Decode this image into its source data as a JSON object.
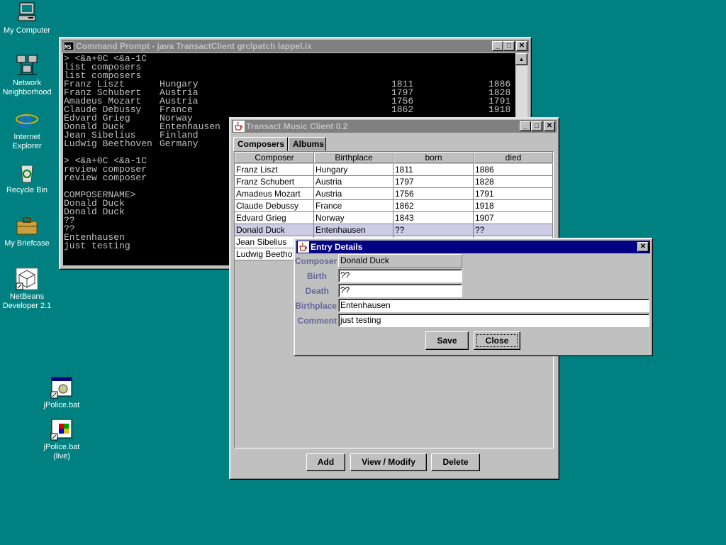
{
  "desktop_icons": [
    {
      "label": "My Computer",
      "icon": "computer-icon"
    },
    {
      "label": "Network Neighborhood",
      "icon": "network-icon"
    },
    {
      "label": "Internet Explorer",
      "icon": "ie-icon"
    },
    {
      "label": "Recycle Bin",
      "icon": "recycle-bin-icon"
    },
    {
      "label": "My Briefcase",
      "icon": "briefcase-icon"
    },
    {
      "label": "NetBeans Developer 2.1",
      "icon": "netbeans-icon"
    },
    {
      "label": "jPolice.bat",
      "icon": "batch-file-icon"
    },
    {
      "label": "jPolice.bat (live)",
      "icon": "batch-file-icon"
    }
  ],
  "console_window": {
    "title": "Command Prompt - java TransactClient grclpatch lappel.ix",
    "lines": [
      {
        "text": "> <&a+0C <&a-1C"
      },
      {
        "text": "list composers"
      },
      {
        "text": "list composers"
      },
      {
        "cols": [
          "Franz Liszt",
          "Hungary",
          "1811",
          "1886"
        ]
      },
      {
        "cols": [
          "Franz Schubert",
          "Austria",
          "1797",
          "1828"
        ]
      },
      {
        "cols": [
          "Amadeus Mozart",
          "Austria",
          "1756",
          "1791"
        ]
      },
      {
        "cols": [
          "Claude Debussy",
          "France",
          "1862",
          "1918"
        ]
      },
      {
        "cols": [
          "Edvard Grieg",
          "Norway",
          "",
          ""
        ]
      },
      {
        "cols": [
          "Donald Duck",
          "Entenhausen",
          "",
          ""
        ]
      },
      {
        "cols": [
          "Jean Sibelius",
          "Finland",
          "",
          ""
        ]
      },
      {
        "cols": [
          "Ludwig Beethoven",
          "Germany",
          "",
          ""
        ]
      },
      {
        "text": ""
      },
      {
        "text": "> <&a+0C <&a-1C"
      },
      {
        "text": "review composer"
      },
      {
        "text": "review composer"
      },
      {
        "text": ""
      },
      {
        "text": "COMPOSERNAME>"
      },
      {
        "text": "Donald Duck"
      },
      {
        "text": "Donald Duck"
      },
      {
        "text": "??"
      },
      {
        "text": "??"
      },
      {
        "text": "Entenhausen"
      },
      {
        "text": "just testing"
      }
    ]
  },
  "music_window": {
    "title": "Transact Music Client 0.2",
    "tabs": [
      "Composers",
      "Albums"
    ],
    "columns": [
      "Composer",
      "Birthplace",
      "born",
      "died"
    ],
    "rows": [
      [
        "Franz Liszt",
        "Hungary",
        "1811",
        "1886"
      ],
      [
        "Franz Schubert",
        "Austria",
        "1797",
        "1828"
      ],
      [
        "Amadeus Mozart",
        "Austria",
        "1756",
        "1791"
      ],
      [
        "Claude Debussy",
        "France",
        "1862",
        "1918"
      ],
      [
        "Edvard Grieg",
        "Norway",
        "1843",
        "1907"
      ],
      [
        "Donald Duck",
        "Entenhausen",
        "??",
        "??"
      ],
      [
        "Jean Sibelius",
        "",
        "",
        ""
      ],
      [
        "Ludwig Beetho",
        "",
        "",
        ""
      ]
    ],
    "selected_row": 5,
    "buttons": {
      "add": "Add",
      "view_modify": "View / Modify",
      "delete": "Delete"
    }
  },
  "dialog": {
    "title": "Entry Details",
    "labels": {
      "composer": "Composer",
      "birth": "Birth",
      "death": "Death",
      "birthplace": "Birthplace",
      "comment": "Comment"
    },
    "values": {
      "composer": "Donald Duck",
      "birth": "??",
      "death": "??",
      "birthplace": "Entenhausen",
      "comment": "just testing"
    },
    "buttons": {
      "save": "Save",
      "close": "Close"
    }
  },
  "window_buttons": {
    "minimize": "_",
    "maximize": "□",
    "close": "✕"
  },
  "colors": {
    "desktop": "#008080",
    "active_title": "#000080",
    "inactive_title": "#808080",
    "selected_row": "#cccce6",
    "label": "#666699"
  }
}
